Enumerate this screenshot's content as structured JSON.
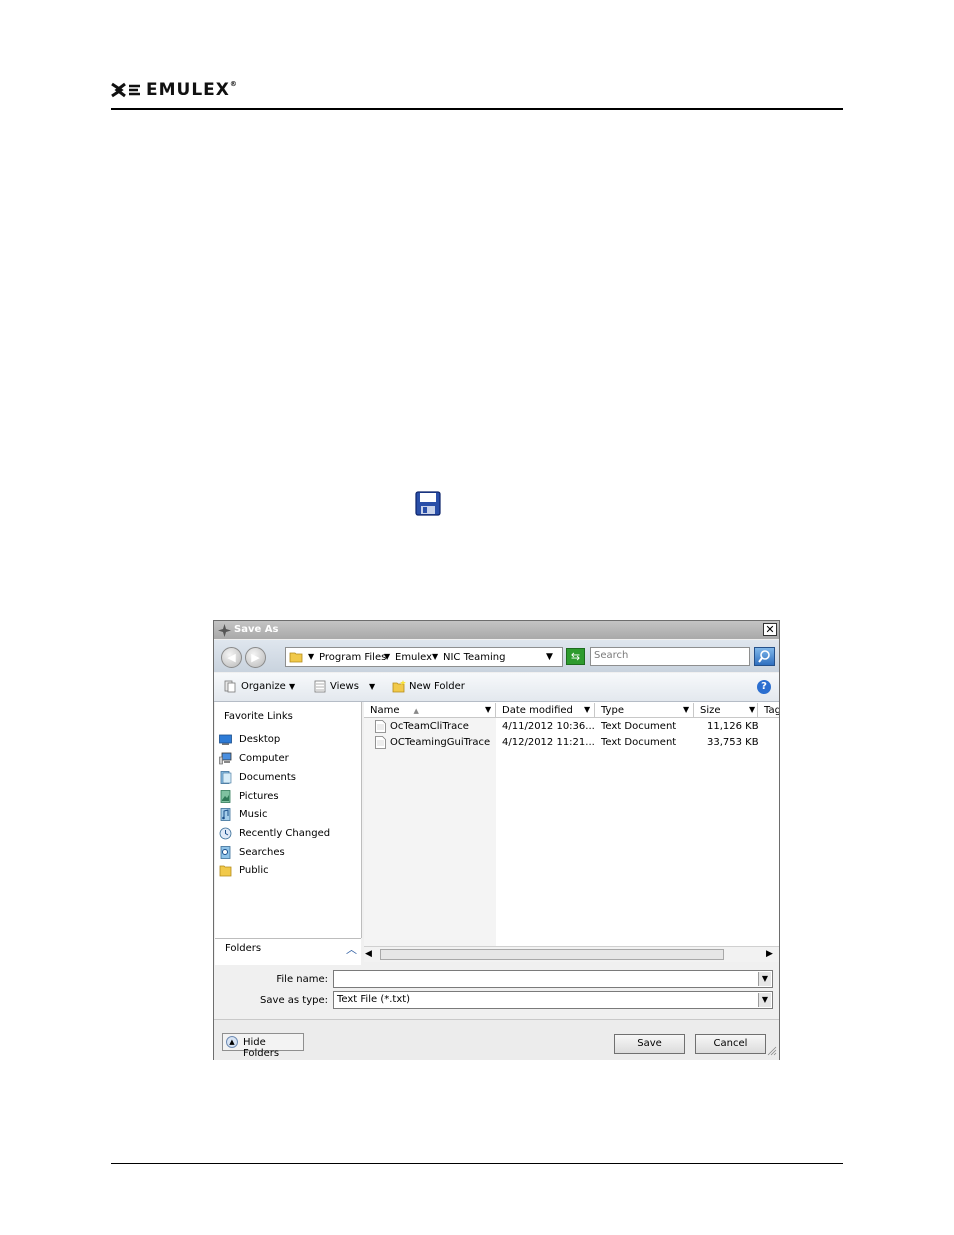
{
  "header": {
    "brand_name": "EMULEX",
    "trademark": "®"
  },
  "inline_icon": "save-floppy-icon",
  "dialog": {
    "title": "Save As",
    "close_label": "✕",
    "breadcrumb": [
      "Program Files",
      "Emulex",
      "NIC Teaming"
    ],
    "search_placeholder": "Search",
    "toolbar": {
      "organize": "Organize",
      "views": "Views",
      "new_folder": "New Folder"
    },
    "favorites_title": "Favorite Links",
    "favorites": [
      {
        "label": "Desktop",
        "icon": "desktop-icon"
      },
      {
        "label": "Computer",
        "icon": "computer-icon"
      },
      {
        "label": "Documents",
        "icon": "documents-icon"
      },
      {
        "label": "Pictures",
        "icon": "pictures-icon"
      },
      {
        "label": "Music",
        "icon": "music-icon"
      },
      {
        "label": "Recently Changed",
        "icon": "recently-changed-icon"
      },
      {
        "label": "Searches",
        "icon": "searches-icon"
      },
      {
        "label": "Public",
        "icon": "folder-icon"
      }
    ],
    "folders_label": "Folders",
    "columns": [
      "Name",
      "Date modified",
      "Type",
      "Size",
      "Tag"
    ],
    "files": [
      {
        "name": "OcTeamCliTrace",
        "date": "4/11/2012 10:36...",
        "type": "Text Document",
        "size": "11,126 KB"
      },
      {
        "name": "OCTeamingGuiTrace",
        "date": "4/12/2012 11:21...",
        "type": "Text Document",
        "size": "33,753 KB"
      }
    ],
    "file_name_label": "File name:",
    "file_name_value": "",
    "save_as_type_label": "Save as type:",
    "save_as_type_value": "Text File (*.txt)",
    "hide_folders_label": "Hide Folders",
    "save_label": "Save",
    "cancel_label": "Cancel",
    "colors": {
      "titlebar": "#b5b5b5",
      "address_bar": "#d3dbe4",
      "refresh_green": "#2e9b2e",
      "search_blue": "#2f6fbf"
    }
  }
}
